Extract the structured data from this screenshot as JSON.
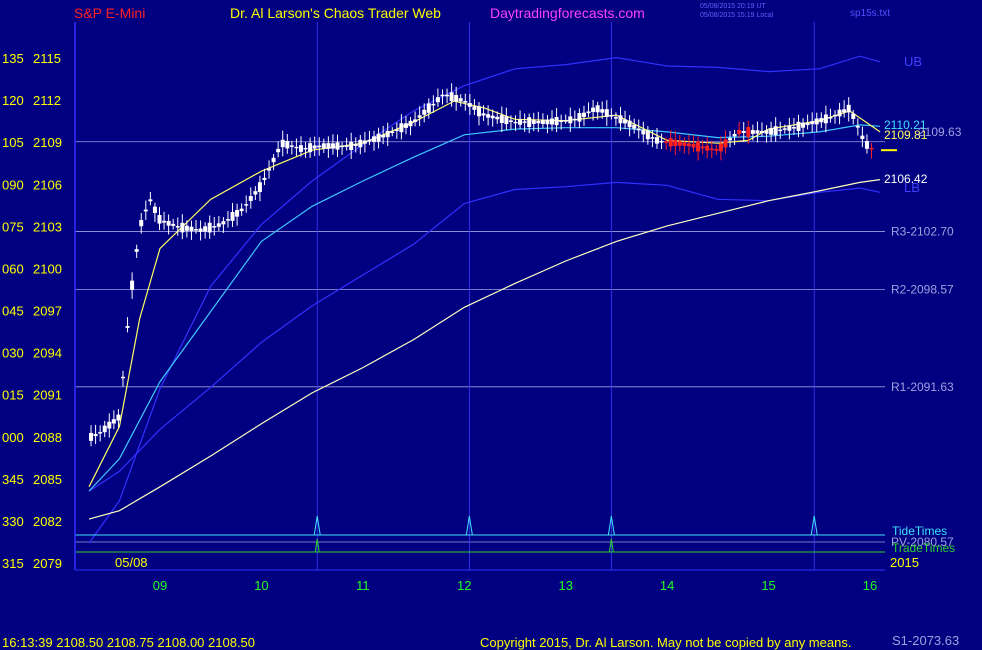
{
  "header": {
    "symbol": "S&P E-Mini",
    "site": "Dr. Al Larson's Chaos Trader Web",
    "url": "Daytradingforecasts.com",
    "time_ut": "05/08/2015 20:19 UT",
    "time_local": "05/08/2015 15:19 Local",
    "scale_label": "sp15s.txt"
  },
  "footer": {
    "quote": "16:13:39  2108.50  2108.75  2108.00  2108.50",
    "copyright": "Copyright 2015, Dr. Al Larson. May not be copied by any means.",
    "s1_label": "S1-2073.63"
  },
  "colors": {
    "background": "#000080",
    "bands": "#3030ff",
    "ema_fast": "#ffff60",
    "ema_mid": "#40c8ff",
    "ema_slow": "#ffffc0",
    "pivot_lines": "#a0a0e0",
    "tide": "#40e0ff",
    "trade": "#30d030",
    "bar_up": "#ffffff",
    "bar_down": "#ff2020",
    "text_yellow": "#ffff00",
    "text_green": "#20ff20",
    "text_red": "#ff2020",
    "text_magenta": "#ff40ff"
  },
  "chart_data": {
    "type": "candlestick",
    "date_label": "05/08",
    "year_label": "2015",
    "x_hours": [
      9,
      10,
      11,
      12,
      13,
      14,
      15,
      16
    ],
    "x_labels": [
      "09",
      "10",
      "11",
      "12",
      "13",
      "14",
      "15",
      "16"
    ],
    "x_range": [
      8.25,
      16.1
    ],
    "ylim": [
      2078.2,
      2117.1
    ],
    "y_ticks": [
      {
        "deg": "135",
        "price": "2115",
        "value": 2115
      },
      {
        "deg": "120",
        "price": "2112",
        "value": 2112
      },
      {
        "deg": "105",
        "price": "2109",
        "value": 2109
      },
      {
        "deg": "090",
        "price": "2106",
        "value": 2106
      },
      {
        "deg": "075",
        "price": "2103",
        "value": 2103
      },
      {
        "deg": "060",
        "price": "2100",
        "value": 2100
      },
      {
        "deg": "045",
        "price": "2097",
        "value": 2097
      },
      {
        "deg": "030",
        "price": "2094",
        "value": 2094
      },
      {
        "deg": "015",
        "price": "2091",
        "value": 2091
      },
      {
        "deg": "000",
        "price": "2088",
        "value": 2088
      },
      {
        "deg": "345",
        "price": "2085",
        "value": 2085
      },
      {
        "deg": "330",
        "price": "2082",
        "value": 2082
      },
      {
        "deg": "315",
        "price": "2079",
        "value": 2079
      }
    ],
    "levels": [
      {
        "label": "R3-2102.70",
        "value": 2102.7
      },
      {
        "label": "R2-2098.57",
        "value": 2098.57
      },
      {
        "label": "R1-2091.63",
        "value": 2091.63
      },
      {
        "label": "PV-2080.57",
        "value": 2080.57
      },
      {
        "label": "",
        "value": 2109.1
      }
    ],
    "value_labels": [
      "2110.21",
      "2109.81",
      "2109.63",
      "2106.42"
    ],
    "band_labels": [
      "UB",
      "LB"
    ],
    "vlines_hours": [
      10.55,
      12.05,
      13.45,
      15.45
    ],
    "tide_times": {
      "label": "TideTimes",
      "spikes_hours": [
        10.55,
        12.05,
        13.45,
        15.45
      ]
    },
    "trade_times": {
      "label": "TradeTimes",
      "spikes_hours": [
        10.55,
        13.45
      ]
    },
    "last_price": 2108.5,
    "series": [
      {
        "name": "UB",
        "points": [
          [
            8.3,
            2080.5
          ],
          [
            8.6,
            2083.5
          ],
          [
            9.0,
            2091.5
          ],
          [
            9.5,
            2098.8
          ],
          [
            10.0,
            2103.2
          ],
          [
            10.5,
            2106.3
          ],
          [
            11.0,
            2108.9
          ],
          [
            11.5,
            2111.3
          ],
          [
            12.0,
            2113.1
          ],
          [
            12.5,
            2114.3
          ],
          [
            13.0,
            2114.6
          ],
          [
            13.5,
            2115.1
          ],
          [
            14.0,
            2114.5
          ],
          [
            14.5,
            2114.4
          ],
          [
            15.0,
            2114.1
          ],
          [
            15.5,
            2114.3
          ],
          [
            15.9,
            2115.2
          ],
          [
            16.1,
            2114.8
          ]
        ]
      },
      {
        "name": "LB",
        "points": [
          [
            8.3,
            2084.2
          ],
          [
            8.6,
            2085.6
          ],
          [
            9.0,
            2088.6
          ],
          [
            9.5,
            2091.6
          ],
          [
            10.0,
            2094.8
          ],
          [
            10.5,
            2097.4
          ],
          [
            11.0,
            2099.6
          ],
          [
            11.5,
            2101.8
          ],
          [
            12.0,
            2104.7
          ],
          [
            12.5,
            2105.7
          ],
          [
            13.0,
            2105.9
          ],
          [
            13.5,
            2106.2
          ],
          [
            14.0,
            2106.0
          ],
          [
            14.5,
            2105.0
          ],
          [
            15.0,
            2104.9
          ],
          [
            15.5,
            2105.5
          ],
          [
            15.9,
            2105.8
          ],
          [
            16.1,
            2105.5
          ]
        ]
      },
      {
        "name": "EMA-slow",
        "points": [
          [
            8.3,
            2082.2
          ],
          [
            8.6,
            2082.8
          ],
          [
            9.0,
            2084.5
          ],
          [
            9.5,
            2086.7
          ],
          [
            10.0,
            2089.0
          ],
          [
            10.5,
            2091.2
          ],
          [
            11.0,
            2093.0
          ],
          [
            11.5,
            2095.0
          ],
          [
            12.0,
            2097.3
          ],
          [
            12.5,
            2099.0
          ],
          [
            13.0,
            2100.6
          ],
          [
            13.5,
            2102.0
          ],
          [
            14.0,
            2103.1
          ],
          [
            14.5,
            2104.0
          ],
          [
            15.0,
            2104.9
          ],
          [
            15.5,
            2105.6
          ],
          [
            15.9,
            2106.2
          ],
          [
            16.1,
            2106.4
          ]
        ]
      },
      {
        "name": "EMA-mid",
        "points": [
          [
            8.3,
            2084.2
          ],
          [
            8.6,
            2086.5
          ],
          [
            9.0,
            2092.0
          ],
          [
            9.5,
            2097.0
          ],
          [
            10.0,
            2102.0
          ],
          [
            10.5,
            2104.5
          ],
          [
            11.0,
            2106.3
          ],
          [
            11.5,
            2108.0
          ],
          [
            12.0,
            2109.6
          ],
          [
            12.5,
            2110.0
          ],
          [
            13.0,
            2110.1
          ],
          [
            13.5,
            2110.1
          ],
          [
            14.0,
            2109.8
          ],
          [
            14.5,
            2109.4
          ],
          [
            15.0,
            2109.5
          ],
          [
            15.5,
            2109.8
          ],
          [
            15.9,
            2110.3
          ],
          [
            16.1,
            2110.2
          ]
        ]
      },
      {
        "name": "EMA-fast",
        "points": [
          [
            8.3,
            2084.5
          ],
          [
            8.6,
            2088.8
          ],
          [
            8.8,
            2096.5
          ],
          [
            9.0,
            2101.5
          ],
          [
            9.5,
            2105.0
          ],
          [
            10.0,
            2107.0
          ],
          [
            10.5,
            2108.5
          ],
          [
            11.0,
            2109.0
          ],
          [
            11.5,
            2110.5
          ],
          [
            11.9,
            2112.0
          ],
          [
            12.2,
            2111.5
          ],
          [
            12.5,
            2110.7
          ],
          [
            13.0,
            2110.6
          ],
          [
            13.5,
            2111.0
          ],
          [
            14.0,
            2109.2
          ],
          [
            14.5,
            2109.0
          ],
          [
            14.8,
            2109.2
          ],
          [
            15.0,
            2110.0
          ],
          [
            15.5,
            2110.6
          ],
          [
            15.8,
            2111.3
          ],
          [
            16.1,
            2109.8
          ]
        ]
      },
      {
        "name": "price",
        "points": [
          [
            8.3,
            2088.0
          ],
          [
            8.4,
            2088.3
          ],
          [
            8.6,
            2089.5
          ],
          [
            8.7,
            2097.5
          ],
          [
            8.8,
            2103.0
          ],
          [
            8.9,
            2105.0
          ],
          [
            9.0,
            2103.5
          ],
          [
            9.2,
            2103.0
          ],
          [
            9.4,
            2102.8
          ],
          [
            9.6,
            2103.2
          ],
          [
            9.8,
            2104.2
          ],
          [
            10.0,
            2106.0
          ],
          [
            10.2,
            2109.0
          ],
          [
            10.4,
            2108.6
          ],
          [
            10.6,
            2108.8
          ],
          [
            10.9,
            2108.8
          ],
          [
            11.2,
            2109.5
          ],
          [
            11.5,
            2110.5
          ],
          [
            11.8,
            2112.5
          ],
          [
            12.0,
            2112.0
          ],
          [
            12.2,
            2111.0
          ],
          [
            12.5,
            2110.5
          ],
          [
            12.8,
            2110.5
          ],
          [
            13.1,
            2110.7
          ],
          [
            13.3,
            2111.5
          ],
          [
            13.6,
            2110.5
          ],
          [
            13.9,
            2109.2
          ],
          [
            14.2,
            2108.9
          ],
          [
            14.5,
            2108.5
          ],
          [
            14.7,
            2109.8
          ],
          [
            15.0,
            2109.8
          ],
          [
            15.3,
            2110.2
          ],
          [
            15.6,
            2110.8
          ],
          [
            15.8,
            2111.5
          ],
          [
            15.95,
            2109.0
          ],
          [
            16.05,
            2108.4
          ]
        ]
      }
    ]
  }
}
